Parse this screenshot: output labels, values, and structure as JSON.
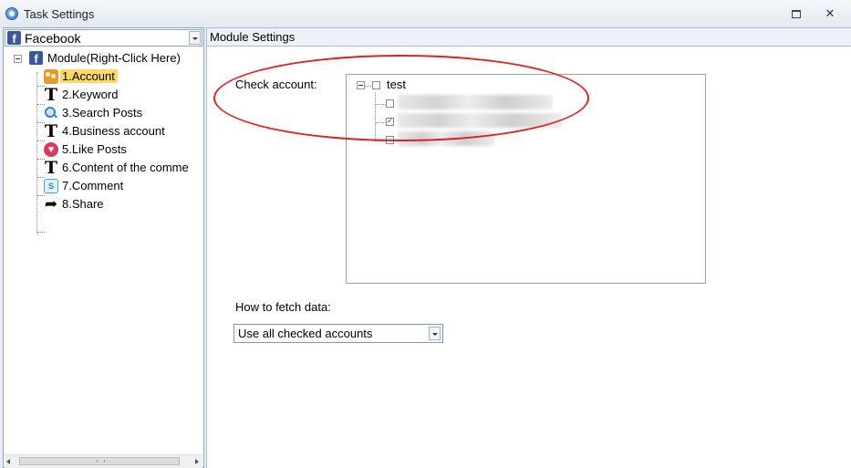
{
  "window": {
    "title": "Task Settings",
    "close_glyph": "✕"
  },
  "site_combo": {
    "value": "Facebook",
    "icon_letter": "f"
  },
  "tree": {
    "root_label": "Module(Right-Click Here)",
    "items": [
      {
        "label": "1.Account",
        "icon": "people-icon",
        "selected": true
      },
      {
        "label": "2.Keyword",
        "icon": "text-t-icon"
      },
      {
        "label": "3.Search Posts",
        "icon": "magnifier-icon"
      },
      {
        "label": "4.Business account",
        "icon": "text-t-icon"
      },
      {
        "label": "5.Like Posts",
        "icon": "heart-icon"
      },
      {
        "label": "6.Content of the comme",
        "icon": "text-t-icon"
      },
      {
        "label": "7.Comment",
        "icon": "comment-icon"
      },
      {
        "label": "8.Share",
        "icon": "share-arrow-icon"
      }
    ]
  },
  "module_settings": {
    "header": "Module Settings",
    "check_account_label": "Check account:",
    "account_group": "test",
    "accounts": [
      {
        "checked": false
      },
      {
        "checked": true
      },
      {
        "checked": false
      }
    ],
    "fetch_label": "How to fetch data:",
    "fetch_value": "Use all checked accounts"
  },
  "annotation_color": "#e02020"
}
